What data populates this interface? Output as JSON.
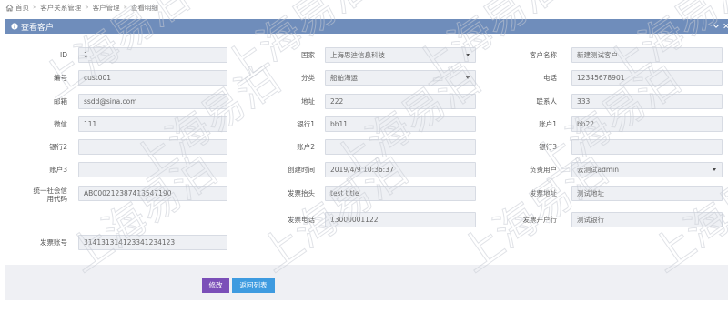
{
  "breadcrumb": [
    "首页",
    "客户关系管理",
    "客户管理",
    "查看明细"
  ],
  "panel": {
    "title": "查看客户"
  },
  "fields": [
    {
      "key": "id",
      "label": "ID",
      "value": "1",
      "type": "text"
    },
    {
      "key": "region",
      "label": "国家",
      "value": "上海思迪信息科技",
      "type": "select"
    },
    {
      "key": "customer_name",
      "label": "客户名称",
      "value": "新建测试客户",
      "type": "text"
    },
    {
      "key": "code",
      "label": "编号",
      "value": "cust001",
      "type": "text"
    },
    {
      "key": "category",
      "label": "分类",
      "value": "船舶海运",
      "type": "select"
    },
    {
      "key": "phone",
      "label": "电话",
      "value": "12345678901",
      "type": "text"
    },
    {
      "key": "email",
      "label": "邮箱",
      "value": "ssdd@sina.com",
      "type": "text"
    },
    {
      "key": "address",
      "label": "地址",
      "value": "222",
      "type": "text"
    },
    {
      "key": "contact",
      "label": "联系人",
      "value": "333",
      "type": "text"
    },
    {
      "key": "wechat",
      "label": "微信",
      "value": "111",
      "type": "text"
    },
    {
      "key": "bank1",
      "label": "银行1",
      "value": "bb11",
      "type": "text"
    },
    {
      "key": "account1",
      "label": "账户1",
      "value": "bb22",
      "type": "text"
    },
    {
      "key": "bank2",
      "label": "银行2",
      "value": "",
      "type": "text"
    },
    {
      "key": "account2",
      "label": "账户2",
      "value": "",
      "type": "text"
    },
    {
      "key": "bank3",
      "label": "银行3",
      "value": "",
      "type": "text"
    },
    {
      "key": "account3",
      "label": "账户3",
      "value": "",
      "type": "text"
    },
    {
      "key": "created_at",
      "label": "创建时间",
      "value": "2019/4/9 10:36:37",
      "type": "text"
    },
    {
      "key": "owner",
      "label": "负责用户",
      "value": "云测试admin",
      "type": "select"
    },
    {
      "key": "credit_code",
      "label": "统一社会信用代码",
      "value": "ABC00212387413547190",
      "type": "text"
    },
    {
      "key": "invoice_title",
      "label": "发票抬头",
      "value": "test title",
      "type": "text"
    },
    {
      "key": "invoice_address",
      "label": "发票地址",
      "value": "测试地址",
      "type": "text"
    },
    {
      "key": "invoice_phone",
      "label": "发票电话",
      "value": "13000001122",
      "type": "text"
    },
    {
      "key": "invoice_bank",
      "label": "发票开户行",
      "value": "测试银行",
      "type": "text"
    },
    {
      "key": "invoice_account",
      "label": "发票账号",
      "value": "314131314123341234123",
      "type": "text"
    }
  ],
  "buttons": {
    "edit": "修改",
    "back": "返回列表"
  },
  "watermark_text": "上海易泊",
  "colors": {
    "header": "#6f8dbb",
    "edit_button": "#7b4fb8",
    "back_button": "#3e9be0"
  }
}
